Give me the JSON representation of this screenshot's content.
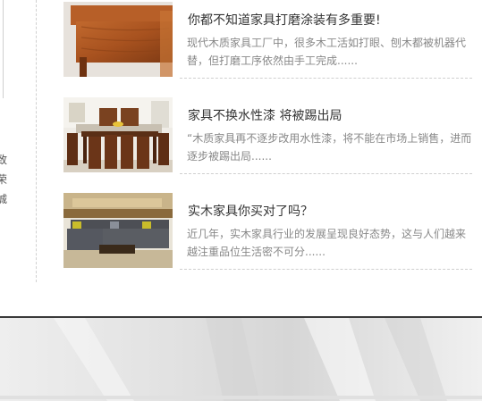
{
  "sidebar": {
    "partial_chars": [
      "致",
      "荣",
      "诚"
    ]
  },
  "articles": [
    {
      "title": "你都不知道家具打磨涂装有多重要!",
      "summary": "现代木质家具工厂中，很多木工活如打眼、刨木都被机器代替，但打磨工序依然由手工完成......"
    },
    {
      "title": "家具不换水性漆 将被踢出局",
      "summary": "“木质家具再不逐步改用水性漆，将不能在市场上销售，进而逐步被踢出局......"
    },
    {
      "title": "实木家具你买对了吗？",
      "summary": "近几年，实木家具行业的发展呈现良好态势，这与人们越来越注重品位生活密不可分......"
    }
  ],
  "colors": {
    "title": "#333333",
    "summary": "#888888",
    "divider": "#cfcfcf",
    "footer_band": "#3a3a3a"
  }
}
